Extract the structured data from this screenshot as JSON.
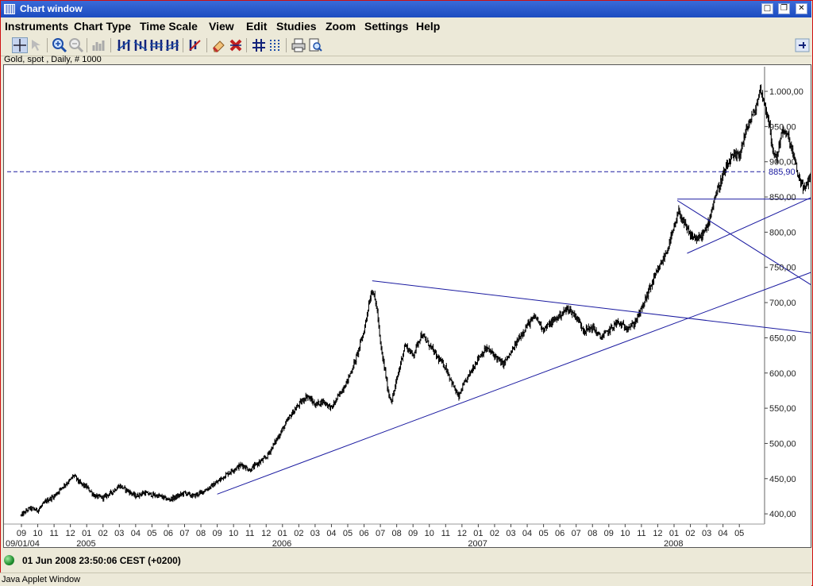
{
  "window": {
    "title": "Chart window"
  },
  "menu": [
    "Instruments",
    "Chart Type",
    "Time Scale",
    "View",
    "Edit",
    "Studies",
    "Zoom",
    "Settings",
    "Help"
  ],
  "toolbar_icons": [
    "crosshair-icon",
    "cursor-icon",
    "zoom-in-icon",
    "zoom-out-icon",
    "histogram-icon",
    "line-tool-icon",
    "channel-tool-icon",
    "fibonacci-tool-icon",
    "parallel-tool-icon",
    "trend-arrow-icon",
    "eraser-icon",
    "delete-icon",
    "grid-icon",
    "settings-grid-icon",
    "print-icon",
    "print-preview-icon",
    "pin-icon"
  ],
  "subtitle": "Gold, spot , Daily, # 1000",
  "status": {
    "datetime": "01 Jun 2008 23:50:06  CEST (+0200)"
  },
  "footer": "Java Applet Window",
  "colors": {
    "titlebar": "#2a5bd1",
    "drawing_lines": "#1a1aa0",
    "price_bars": "#000000",
    "current_price_line": "#1a1aa0",
    "status_led": "#1f8f2f"
  },
  "chart_data": {
    "type": "ohlc",
    "instrument": "Gold, spot",
    "timeframe": "Daily",
    "ylim": [
      390,
      1035
    ],
    "y_ticks": [
      400,
      450,
      500,
      550,
      600,
      650,
      700,
      750,
      800,
      850,
      900,
      950,
      1000
    ],
    "y_tick_labels": [
      "400,00",
      "450,00",
      "500,00",
      "550,00",
      "600,00",
      "650,00",
      "700,00",
      "750,00",
      "800,00",
      "850,00",
      "900,00",
      "950,00",
      "1.000,00"
    ],
    "x_month_labels": [
      "09",
      "10",
      "11",
      "12",
      "01",
      "02",
      "03",
      "04",
      "05",
      "06",
      "07",
      "08",
      "09",
      "10",
      "11",
      "12",
      "01",
      "02",
      "03",
      "04",
      "05",
      "06",
      "07",
      "08",
      "09",
      "10",
      "11",
      "12",
      "01",
      "02",
      "03",
      "04",
      "05",
      "06",
      "07",
      "08",
      "09",
      "10",
      "11",
      "12",
      "01",
      "02",
      "03",
      "04",
      "05"
    ],
    "x_year_labels": [
      {
        "label": "09/01/04",
        "month_index": 0
      },
      {
        "label": "2005",
        "month_index": 4
      },
      {
        "label": "2006",
        "month_index": 16
      },
      {
        "label": "2007",
        "month_index": 28
      },
      {
        "label": "2008",
        "month_index": 40
      }
    ],
    "current_price": {
      "value": 885.9,
      "label": "885,90"
    },
    "price_path": [
      [
        0,
        398
      ],
      [
        0.5,
        408
      ],
      [
        1,
        405
      ],
      [
        1.5,
        418
      ],
      [
        2,
        425
      ],
      [
        2.5,
        438
      ],
      [
        3,
        448
      ],
      [
        3.2,
        455
      ],
      [
        3.6,
        443
      ],
      [
        4,
        438
      ],
      [
        4.5,
        425
      ],
      [
        5,
        423
      ],
      [
        5.5,
        430
      ],
      [
        6,
        440
      ],
      [
        6.5,
        433
      ],
      [
        7,
        425
      ],
      [
        7.5,
        430
      ],
      [
        8,
        427
      ],
      [
        8.5,
        425
      ],
      [
        9,
        420
      ],
      [
        9.5,
        424
      ],
      [
        10,
        430
      ],
      [
        10.5,
        425
      ],
      [
        11,
        430
      ],
      [
        11.5,
        437
      ],
      [
        12,
        445
      ],
      [
        12.5,
        455
      ],
      [
        13,
        463
      ],
      [
        13.5,
        470
      ],
      [
        14,
        462
      ],
      [
        14.5,
        472
      ],
      [
        15,
        480
      ],
      [
        15.5,
        500
      ],
      [
        16,
        520
      ],
      [
        16.5,
        540
      ],
      [
        17,
        555
      ],
      [
        17.5,
        568
      ],
      [
        18,
        555
      ],
      [
        18.5,
        560
      ],
      [
        19,
        550
      ],
      [
        19.5,
        570
      ],
      [
        20,
        590
      ],
      [
        20.5,
        620
      ],
      [
        21,
        660
      ],
      [
        21.3,
        700
      ],
      [
        21.5,
        720
      ],
      [
        21.8,
        690
      ],
      [
        22,
        640
      ],
      [
        22.3,
        600
      ],
      [
        22.5,
        570
      ],
      [
        22.7,
        560
      ],
      [
        23,
        590
      ],
      [
        23.3,
        620
      ],
      [
        23.5,
        640
      ],
      [
        24,
        625
      ],
      [
        24.5,
        655
      ],
      [
        25,
        640
      ],
      [
        25.5,
        622
      ],
      [
        26,
        608
      ],
      [
        26.5,
        580
      ],
      [
        26.8,
        565
      ],
      [
        27,
        578
      ],
      [
        27.5,
        600
      ],
      [
        28,
        622
      ],
      [
        28.5,
        635
      ],
      [
        29,
        625
      ],
      [
        29.5,
        612
      ],
      [
        30,
        628
      ],
      [
        30.5,
        650
      ],
      [
        31,
        668
      ],
      [
        31.5,
        680
      ],
      [
        32,
        662
      ],
      [
        32.5,
        672
      ],
      [
        33,
        682
      ],
      [
        33.5,
        692
      ],
      [
        34,
        680
      ],
      [
        34.5,
        660
      ],
      [
        35,
        665
      ],
      [
        35.5,
        650
      ],
      [
        36,
        660
      ],
      [
        36.5,
        672
      ],
      [
        37,
        665
      ],
      [
        37.5,
        668
      ],
      [
        38,
        690
      ],
      [
        38.5,
        720
      ],
      [
        39,
        745
      ],
      [
        39.5,
        770
      ],
      [
        40,
        805
      ],
      [
        40.3,
        830
      ],
      [
        40.6,
        812
      ],
      [
        41,
        795
      ],
      [
        41.5,
        790
      ],
      [
        42,
        805
      ],
      [
        42.5,
        850
      ],
      [
        43,
        880
      ],
      [
        43.5,
        905
      ],
      [
        44,
        910
      ],
      [
        44.5,
        950
      ],
      [
        45,
        975
      ],
      [
        45.3,
        1005
      ],
      [
        45.5,
        985
      ],
      [
        45.8,
        960
      ],
      [
        46,
        918
      ],
      [
        46.3,
        905
      ],
      [
        46.6,
        945
      ],
      [
        47,
        935
      ],
      [
        47.3,
        910
      ],
      [
        47.6,
        880
      ],
      [
        48,
        860
      ],
      [
        48.3,
        878
      ],
      [
        48.6,
        885
      ],
      [
        49,
        935
      ],
      [
        49.3,
        920
      ],
      [
        49.6,
        886
      ]
    ],
    "drawn_lines": [
      {
        "name": "long-term-support",
        "from": [
          12.0,
          428
        ],
        "to": [
          50.6,
          762
        ]
      },
      {
        "name": "resistance-from-2006-high",
        "from": [
          21.5,
          731
        ],
        "to": [
          50.6,
          651
        ]
      },
      {
        "name": "horizontal-850",
        "from": [
          40.2,
          847
        ],
        "to": [
          50.6,
          847
        ]
      },
      {
        "name": "diagonal-from-nov-high",
        "from": [
          40.2,
          845
        ],
        "to": [
          50.6,
          693
        ]
      },
      {
        "name": "support-from-dec-low",
        "from": [
          40.8,
          770
        ],
        "to": [
          50.4,
          870
        ]
      }
    ]
  }
}
